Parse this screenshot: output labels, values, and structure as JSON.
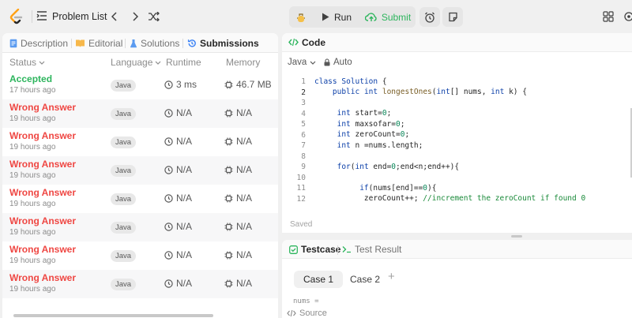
{
  "topbar": {
    "problem_list": "Problem List",
    "run_label": "Run",
    "submit_label": "Submit",
    "colors": {
      "submit": "#2db55d",
      "logo": "#ffa116"
    }
  },
  "left_panel": {
    "tabs": [
      {
        "label": "Description"
      },
      {
        "label": "Editorial"
      },
      {
        "label": "Solutions"
      },
      {
        "label": "Submissions"
      }
    ],
    "columns": {
      "status": "Status",
      "language": "Language",
      "runtime": "Runtime",
      "memory": "Memory"
    },
    "rows": [
      {
        "status": "Accepted",
        "time": "17 hours ago",
        "lang": "Java",
        "runtime": "3 ms",
        "memory": "46.7 MB"
      },
      {
        "status": "Wrong Answer",
        "time": "19 hours ago",
        "lang": "Java",
        "runtime": "N/A",
        "memory": "N/A"
      },
      {
        "status": "Wrong Answer",
        "time": "19 hours ago",
        "lang": "Java",
        "runtime": "N/A",
        "memory": "N/A"
      },
      {
        "status": "Wrong Answer",
        "time": "19 hours ago",
        "lang": "Java",
        "runtime": "N/A",
        "memory": "N/A"
      },
      {
        "status": "Wrong Answer",
        "time": "19 hours ago",
        "lang": "Java",
        "runtime": "N/A",
        "memory": "N/A"
      },
      {
        "status": "Wrong Answer",
        "time": "19 hours ago",
        "lang": "Java",
        "runtime": "N/A",
        "memory": "N/A"
      },
      {
        "status": "Wrong Answer",
        "time": "19 hours ago",
        "lang": "Java",
        "runtime": "N/A",
        "memory": "N/A"
      },
      {
        "status": "Wrong Answer",
        "time": "19 hours ago",
        "lang": "Java",
        "runtime": "N/A",
        "memory": "N/A"
      }
    ]
  },
  "code_panel": {
    "title": "Code",
    "language": "Java",
    "mode": "Auto",
    "saved": "Saved",
    "line_numbers": [
      "1",
      "2",
      "3",
      "4",
      "5",
      "6",
      "7",
      "8",
      "9",
      "10",
      "11",
      "12"
    ]
  },
  "test_panel": {
    "testcase_label": "Testcase",
    "result_label": "Test Result",
    "cases": [
      "Case 1",
      "Case 2"
    ],
    "input_label": "nums =",
    "source_label": "Source"
  }
}
